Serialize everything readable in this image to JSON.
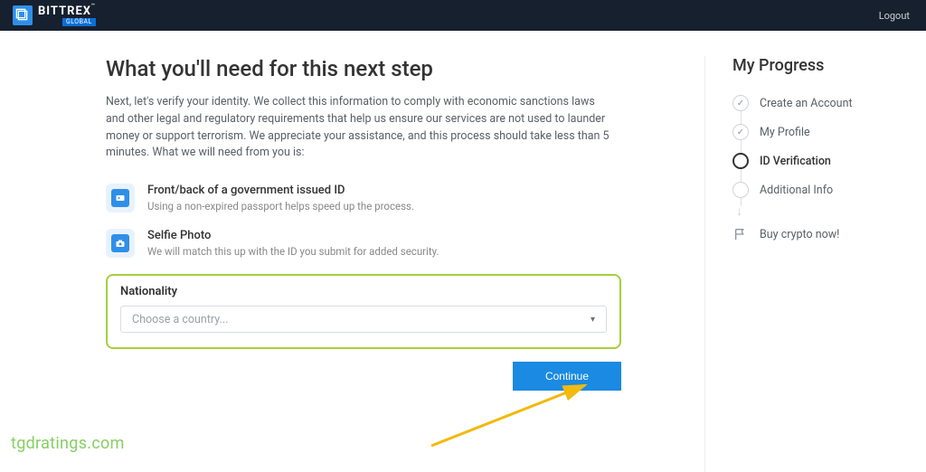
{
  "header": {
    "brand_main": "BITTREX",
    "brand_tm": "™",
    "brand_sub": "GLOBAL",
    "logout": "Logout"
  },
  "main": {
    "title": "What you'll need for this next step",
    "intro": "Next, let's verify your identity. We collect this information to comply with economic sanctions laws and other legal and regulatory requirements that help us ensure our services are not used to launder money or support terrorism. We appreciate your assistance, and this process should take less than 5 minutes. What we will need from you is:",
    "req1_title": "Front/back of a government issued ID",
    "req1_sub": "Using a non-expired passport helps speed up the process.",
    "req2_title": "Selfie Photo",
    "req2_sub": "We will match this up with the ID you submit for added security.",
    "nat_label": "Nationality",
    "nat_placeholder": "Choose a country...",
    "continue": "Continue"
  },
  "progress": {
    "title": "My Progress",
    "steps": {
      "s1": "Create an Account",
      "s2": "My Profile",
      "s3": "ID Verification",
      "s4": "Additional Info",
      "s5": "Buy crypto now!"
    }
  },
  "watermark": "tgdratings.com"
}
